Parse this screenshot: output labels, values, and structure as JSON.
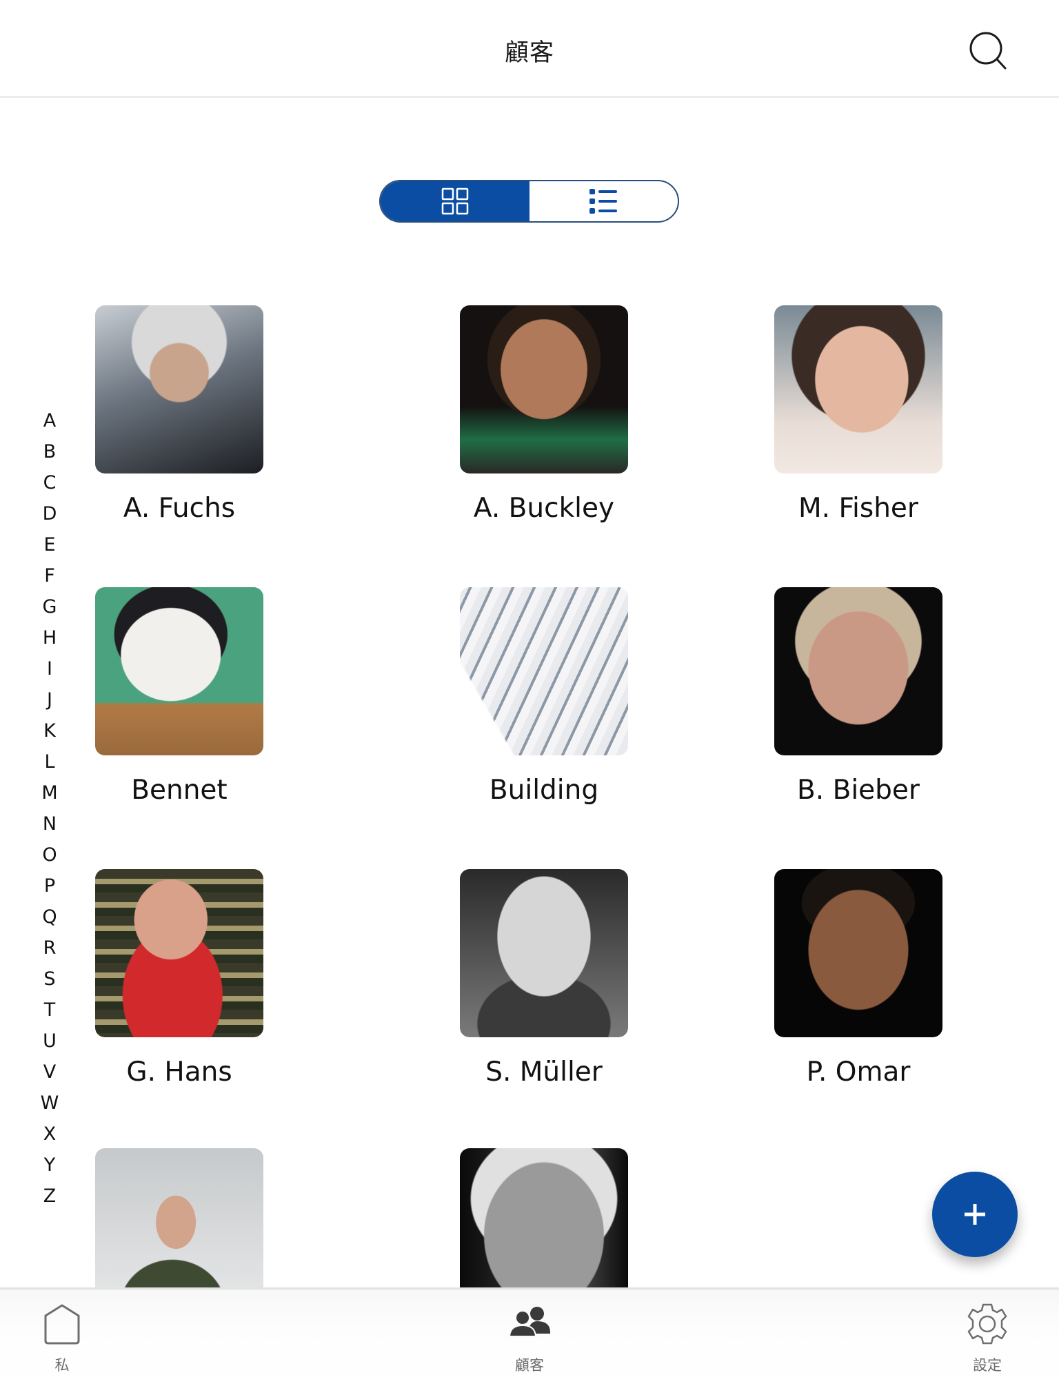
{
  "header": {
    "title": "顧客",
    "search_icon": "search-icon"
  },
  "view_toggle": {
    "options": [
      {
        "id": "grid",
        "icon": "grid-icon",
        "active": true
      },
      {
        "id": "list",
        "icon": "list-icon",
        "active": false
      }
    ],
    "accent_color": "#0a4da2"
  },
  "alphabet_index": [
    "A",
    "B",
    "C",
    "D",
    "E",
    "F",
    "G",
    "H",
    "I",
    "J",
    "K",
    "L",
    "M",
    "N",
    "O",
    "P",
    "Q",
    "R",
    "S",
    "T",
    "U",
    "V",
    "W",
    "X",
    "Y",
    "Z"
  ],
  "customers": [
    {
      "name": "A. Fuchs",
      "photo": "elderly woman with short grey hair, smiling, grey jacket"
    },
    {
      "name": "A. Buckley",
      "photo": "laughing woman with curly dark hair, dark background"
    },
    {
      "name": "M. Fisher",
      "photo": "smiling woman with dark hair, floral blouse"
    },
    {
      "name": "Bennet",
      "photo": "black and white cat on green background"
    },
    {
      "name": "Building",
      "photo": "white modern building facade"
    },
    {
      "name": "B. Bieber",
      "photo": "older woman with glasses, dark background"
    },
    {
      "name": "G. Hans",
      "photo": "red-haired woman in red blazer"
    },
    {
      "name": "S. Müller",
      "photo": "bald man with glasses and beard, black and white"
    },
    {
      "name": "P. Omar",
      "photo": "smiling bearded man, dark background"
    },
    {
      "name": "",
      "photo": "man with glasses in green polo, grey background"
    },
    {
      "name": "",
      "photo": "elderly man with grey hair and mustache, black and white"
    }
  ],
  "fab": {
    "icon": "plus-icon",
    "label": "+"
  },
  "tabbar": {
    "tabs": [
      {
        "label": "私",
        "icon": "home-icon",
        "active": false
      },
      {
        "label": "顧客",
        "icon": "users-icon",
        "active": true
      },
      {
        "label": "設定",
        "icon": "gear-icon",
        "active": false
      }
    ]
  }
}
